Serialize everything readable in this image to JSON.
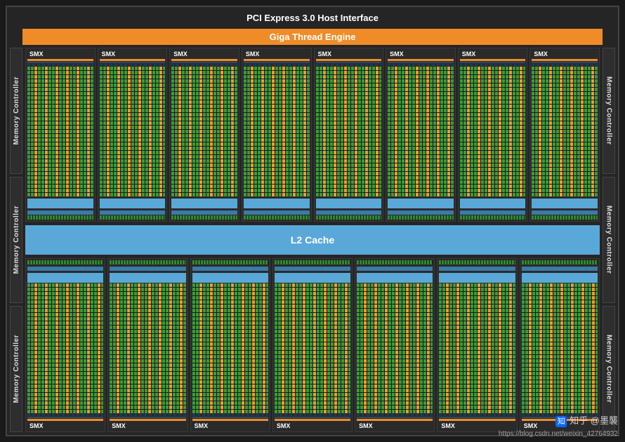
{
  "header": {
    "pci": "PCI Express 3.0 Host Interface",
    "gte": "Giga Thread Engine"
  },
  "smx_label": "SMX",
  "smx_top_count": 8,
  "smx_bottom_count": 7,
  "l2_label": "L2 Cache",
  "memory_controller_label": "Memory Controller",
  "mc_per_side": 3,
  "watermark": {
    "text": "知乎 @墨襲",
    "url": "https://blog.csdn.net/weixin_42764932"
  }
}
